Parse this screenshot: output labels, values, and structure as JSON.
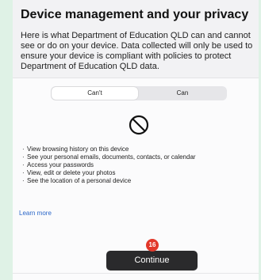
{
  "header": {
    "title": "Device management and your privacy",
    "description": "Here is what Department of Education QLD can and cannot see or do on your device. Data collected will only be used to ensure your device is compliant with policies to protect Department of Education QLD data."
  },
  "tabs": [
    {
      "label": "Can't",
      "selected": true
    },
    {
      "label": "Can",
      "selected": false
    }
  ],
  "icon": "prohibited-icon",
  "cant_list": [
    "View browsing history on this device",
    "See your personal emails, documents, contacts, or calendar",
    "Access your passwords",
    "View, edit or delete your photos",
    "See the location of a personal device"
  ],
  "learn_more": "Learn more",
  "badge": "16",
  "continue_label": "Continue",
  "colors": {
    "background_mint": "#dff2e6",
    "panel": "#f2f2f4",
    "link": "#2a66c8",
    "button": "#2a2a2c",
    "badge": "#e2382a"
  }
}
